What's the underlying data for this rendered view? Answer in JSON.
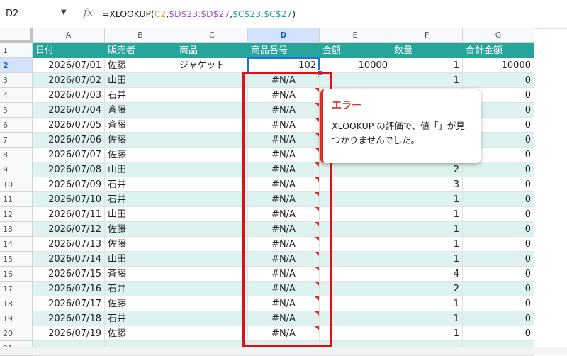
{
  "formula_bar": {
    "name_box": "D2",
    "name_box_arrow": "▼",
    "fx_label": "fx",
    "formula_parts": [
      "=XLOOKUP(",
      "C2",
      ",",
      "$D$23:$D$27",
      ",",
      "$C$23:$C$27",
      ")"
    ]
  },
  "columns": [
    "A",
    "B",
    "C",
    "D",
    "E",
    "F",
    "G"
  ],
  "selected_column": "D",
  "header_row": {
    "row_number": "1",
    "cells": [
      "日付",
      "販売者",
      "商品",
      "商品番号",
      "金額",
      "数量",
      "合計金額"
    ]
  },
  "rows": [
    {
      "n": "2",
      "date": "2026/07/01",
      "seller": "佐藤",
      "product": "ジャケット",
      "code": "102",
      "amount": "10000",
      "qty": "1",
      "total": "10000"
    },
    {
      "n": "3",
      "date": "2026/07/02",
      "seller": "山田",
      "product": "",
      "code": "#N/A",
      "amount": "",
      "qty": "1",
      "total": "0"
    },
    {
      "n": "4",
      "date": "2026/07/03",
      "seller": "石井",
      "product": "",
      "code": "#N/A",
      "amount": "",
      "qty": "",
      "total": "0"
    },
    {
      "n": "5",
      "date": "2026/07/04",
      "seller": "斉藤",
      "product": "",
      "code": "#N/A",
      "amount": "",
      "qty": "",
      "total": "0"
    },
    {
      "n": "6",
      "date": "2026/07/05",
      "seller": "斉藤",
      "product": "",
      "code": "#N/A",
      "amount": "",
      "qty": "",
      "total": "0"
    },
    {
      "n": "7",
      "date": "2026/07/06",
      "seller": "佐藤",
      "product": "",
      "code": "#N/A",
      "amount": "",
      "qty": "",
      "total": "0"
    },
    {
      "n": "8",
      "date": "2026/07/07",
      "seller": "佐藤",
      "product": "",
      "code": "#N/A",
      "amount": "",
      "qty": "",
      "total": "0"
    },
    {
      "n": "9",
      "date": "2026/07/08",
      "seller": "山田",
      "product": "",
      "code": "#N/A",
      "amount": "",
      "qty": "2",
      "total": "0"
    },
    {
      "n": "10",
      "date": "2026/07/09",
      "seller": "石井",
      "product": "",
      "code": "#N/A",
      "amount": "",
      "qty": "3",
      "total": "0"
    },
    {
      "n": "11",
      "date": "2026/07/10",
      "seller": "石井",
      "product": "",
      "code": "#N/A",
      "amount": "",
      "qty": "1",
      "total": "0"
    },
    {
      "n": "12",
      "date": "2026/07/11",
      "seller": "山田",
      "product": "",
      "code": "#N/A",
      "amount": "",
      "qty": "1",
      "total": "0"
    },
    {
      "n": "13",
      "date": "2026/07/12",
      "seller": "佐藤",
      "product": "",
      "code": "#N/A",
      "amount": "",
      "qty": "1",
      "total": "0"
    },
    {
      "n": "14",
      "date": "2026/07/13",
      "seller": "佐藤",
      "product": "",
      "code": "#N/A",
      "amount": "",
      "qty": "1",
      "total": "0"
    },
    {
      "n": "15",
      "date": "2026/07/14",
      "seller": "山田",
      "product": "",
      "code": "#N/A",
      "amount": "",
      "qty": "1",
      "total": "0"
    },
    {
      "n": "16",
      "date": "2026/07/15",
      "seller": "斉藤",
      "product": "",
      "code": "#N/A",
      "amount": "",
      "qty": "4",
      "total": "0"
    },
    {
      "n": "17",
      "date": "2026/07/16",
      "seller": "石井",
      "product": "",
      "code": "#N/A",
      "amount": "",
      "qty": "2",
      "total": "0"
    },
    {
      "n": "18",
      "date": "2026/07/17",
      "seller": "佐藤",
      "product": "",
      "code": "#N/A",
      "amount": "",
      "qty": "1",
      "total": "0"
    },
    {
      "n": "19",
      "date": "2026/07/18",
      "seller": "石井",
      "product": "",
      "code": "#N/A",
      "amount": "",
      "qty": "1",
      "total": "0"
    },
    {
      "n": "20",
      "date": "2026/07/19",
      "seller": "佐藤",
      "product": "",
      "code": "#N/A",
      "amount": "",
      "qty": "1",
      "total": "0"
    },
    {
      "n": "21",
      "date": "",
      "seller": "",
      "product": "",
      "code": "",
      "amount": "",
      "qty": "",
      "total": ""
    }
  ],
  "selected_cell": "D2",
  "error_popup": {
    "title": "エラー",
    "message": "XLOOKUP の評価で、値「」が見つかりませんでした。"
  },
  "colors": {
    "header_teal": "#26a59a",
    "date_column_green": "#b6d7a8",
    "band_light": "#def2ef",
    "highlight_red": "#e0101b",
    "error_red": "#d93025",
    "selection_blue": "#1a73e8"
  }
}
